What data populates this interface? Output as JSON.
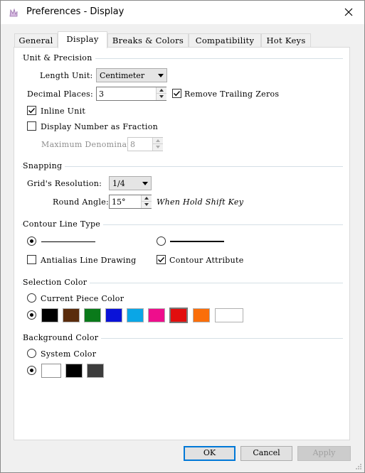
{
  "window": {
    "title": "Preferences - Display"
  },
  "tabs": [
    {
      "label": "General"
    },
    {
      "label": "Display"
    },
    {
      "label": "Breaks & Colors"
    },
    {
      "label": "Compatibility"
    },
    {
      "label": "Hot Keys"
    }
  ],
  "unit_precision": {
    "title": "Unit & Precision",
    "length_unit_label": "Length Unit:",
    "length_unit_value": "Centimeter",
    "decimal_places_label": "Decimal Places:",
    "decimal_places_value": "3",
    "remove_trailing_zeros_label": "Remove Trailing Zeros",
    "remove_trailing_zeros_checked": true,
    "inline_unit_label": "Inline Unit",
    "inline_unit_checked": true,
    "display_fraction_label": "Display Number as Fraction",
    "display_fraction_checked": false,
    "max_denominator_label": "Maximum Denominator",
    "max_denominator_value": "8"
  },
  "snapping": {
    "title": "Snapping",
    "grid_resolution_label": "Grid's Resolution:",
    "grid_resolution_value": "1/4",
    "round_angle_label": "Round Angle:",
    "round_angle_value": "15°",
    "round_angle_hint": "When Hold Shift Key"
  },
  "contour": {
    "title": "Contour Line Type",
    "thin_selected": true,
    "thick_selected": false,
    "antialias_label": "Antialias Line Drawing",
    "antialias_checked": false,
    "contour_attribute_label": "Contour Attribute",
    "contour_attribute_checked": true
  },
  "selection_color": {
    "title": "Selection Color",
    "current_piece_label": "Current Piece Color",
    "current_piece_selected": false,
    "custom_selected": true,
    "swatches": [
      "#000000",
      "#5a2c0c",
      "#0a7a1a",
      "#0a12d8",
      "#0aa6e6",
      "#ee0e8c",
      "#e20e0e",
      "#fa6e0a",
      "#ffffff"
    ],
    "selected_swatch": "#e20e0e"
  },
  "background_color": {
    "title": "Background Color",
    "system_color_label": "System Color",
    "system_color_selected": false,
    "custom_selected": true,
    "swatches": [
      "#ffffff",
      "#000000",
      "#3c3c3c"
    ]
  },
  "footer": {
    "ok_label": "OK",
    "cancel_label": "Cancel",
    "apply_label": "Apply"
  }
}
